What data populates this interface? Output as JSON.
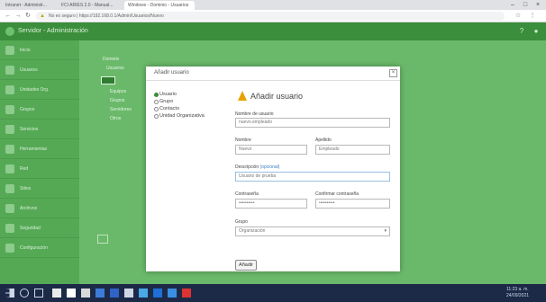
{
  "browser": {
    "tabs": [
      "Intranet - Administr...",
      "FCI ARIES 2.0 - Manual...",
      "Windows - Dominio - Usuarios"
    ],
    "address": "No es seguro | https://192.168.0.1/Admin/Usuarios/Nuevo",
    "window_controls": [
      "–",
      "□",
      "×"
    ]
  },
  "app": {
    "title": "Servidor - Administración",
    "sidebar": [
      "Inicio",
      "Usuarios",
      "Unidades Org.",
      "Grupos",
      "Servicios",
      "Herramientas",
      "Red",
      "Sitios",
      "Archivos",
      "Seguridad",
      "Configuración"
    ]
  },
  "tree": {
    "nodes": [
      "Dominio",
      "Usuarios",
      "Equipos",
      "Grupos",
      "Servidores",
      "Otros"
    ]
  },
  "modal": {
    "title": "Añadir usuario",
    "close": "×",
    "menu": [
      "Usuario",
      "Grupo",
      "Contacto",
      "Unidad Organizativa"
    ],
    "heading": "Añadir usuario",
    "fields": {
      "username_label": "Nombre de usuario",
      "username_value": "nuevo.empleado",
      "name_label": "Nombre",
      "name_value": "Nuevo",
      "surname_label": "Apellido",
      "surname_value": "Empleado",
      "description_label": "Descripción",
      "description_optional": "(opcional)",
      "description_value": "Usuario de prueba",
      "password_label": "Contraseña",
      "password_value": "••••••••••",
      "password_confirm_label": "Confirmar contraseña",
      "password_confirm_value": "••••••••••",
      "group_label": "Grupo",
      "group_value": "Organización",
      "submit": "Añadir"
    }
  },
  "taskbar": {
    "clock_time": "11:23 a. m.",
    "clock_date": "24/09/2021"
  },
  "colors": {
    "appbar": "#3b8e3b",
    "sidebar": "#55a955",
    "content": "#6ab96a",
    "taskbar": "#1c2a48",
    "accent": "#e8a200"
  }
}
